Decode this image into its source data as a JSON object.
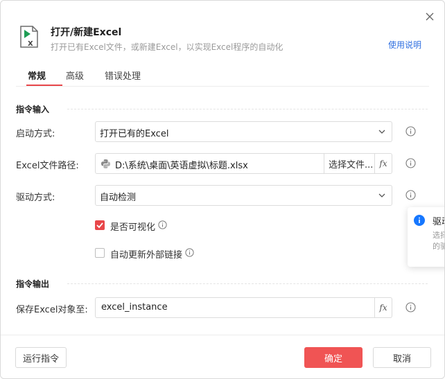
{
  "header": {
    "title": "打开/新建Excel",
    "subtitle": "打开已有Excel文件，或新建Excel，以实现Excel程序的自动化",
    "help_link": "使用说明"
  },
  "tabs": [
    {
      "label": "常规",
      "active": true
    },
    {
      "label": "高级",
      "active": false
    },
    {
      "label": "错误处理",
      "active": false
    }
  ],
  "input_section": {
    "title": "指令输入",
    "launch_mode": {
      "label": "启动方式:",
      "value": "打开已有的Excel"
    },
    "file_path": {
      "label": "Excel文件路径:",
      "value": "D:\\系统\\桌面\\英语虚拟\\标题.xlsx",
      "choose_label": "选择文件..."
    },
    "driver_mode": {
      "label": "驱动方式:",
      "value": "自动检测"
    },
    "visible_checkbox": {
      "label": "是否可视化",
      "checked": true
    },
    "update_links_checkbox": {
      "label": "自动更新外部链接",
      "checked": false
    }
  },
  "output_section": {
    "title": "指令输出",
    "save_var": {
      "label": "保存Excel对象至:",
      "value": "excel_instance"
    }
  },
  "tooltip": {
    "title": "驱动",
    "body_line1": "选择",
    "body_line2": "的驱"
  },
  "footer": {
    "run_label": "运行指令",
    "ok_label": "确定",
    "cancel_label": "取消"
  },
  "fx_label": "fx",
  "colors": {
    "accent_red": "#e8474a",
    "ok_button": "#f05454",
    "link_blue": "#2f6fe0",
    "info_blue": "#1677ff",
    "excel_green": "#1f9d55"
  }
}
